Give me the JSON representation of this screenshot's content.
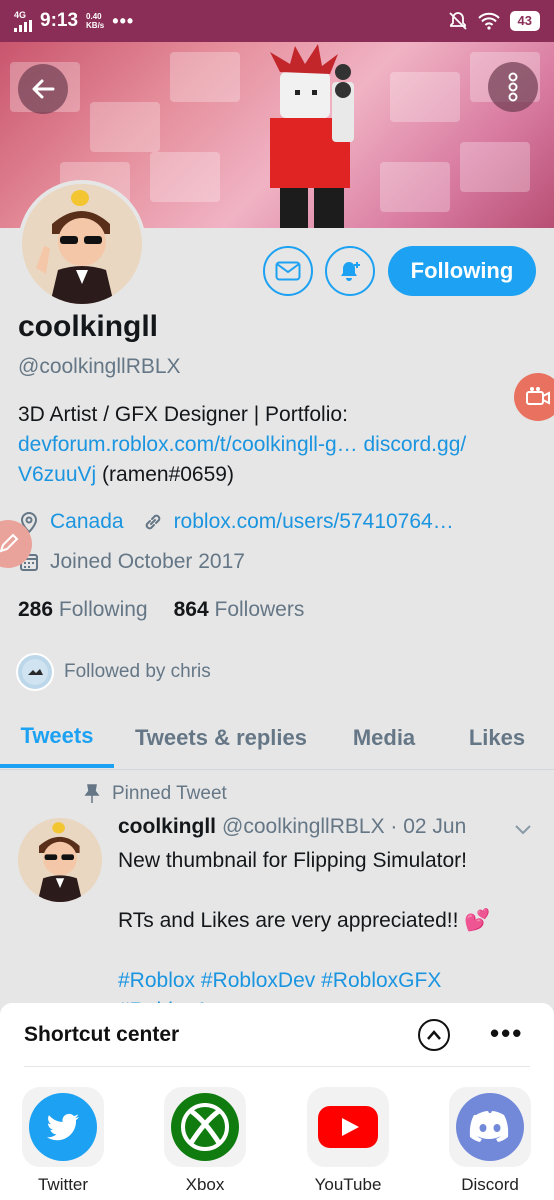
{
  "status_bar": {
    "network": "4G",
    "time": "9:13",
    "speed_value": "0.40",
    "speed_unit": "KB/s",
    "more": "•••",
    "battery": "43"
  },
  "profile": {
    "name": "coolkingll",
    "handle": "@coolkingllRBLX",
    "bio_text": "3D Artist / GFX Designer | Portfolio: ",
    "bio_link1": "devforum.roblox.com/t/coolkingll-g…",
    "bio_link2": "discord.gg/",
    "bio_link2b": "V6zuuVj",
    "bio_tail": " (ramen#0659)",
    "location": "Canada",
    "website": "roblox.com/users/57410764…",
    "joined": "Joined October 2017",
    "following_count": "286",
    "following_label": "Following",
    "followers_count": "864",
    "followers_label": "Followers",
    "followed_by": "Followed by chris",
    "follow_button": "Following"
  },
  "tabs": [
    {
      "label": "Tweets",
      "active": true
    },
    {
      "label": "Tweets & replies",
      "active": false
    },
    {
      "label": "Media",
      "active": false
    },
    {
      "label": "Likes",
      "active": false
    }
  ],
  "tweet": {
    "pinned_label": "Pinned Tweet",
    "author": "coolkingll",
    "handle_date": "@coolkingllRBLX · 02 Jun",
    "line1": "New thumbnail for Flipping Simulator!",
    "line2": "RTs and Likes are very appreciated!! 💕",
    "tags": "#Roblox #RobloxDev #RobloxGFX",
    "tags_cut": "#RobloxArt"
  },
  "shortcut_center": {
    "title": "Shortcut center",
    "more": "•••",
    "apps": [
      {
        "label": "Twitter",
        "color": "#1da1f2"
      },
      {
        "label": "Xbox",
        "color": "#107c10"
      },
      {
        "label": "YouTube",
        "color": "#ff0000"
      },
      {
        "label": "Discord",
        "color": "#7289da"
      }
    ]
  },
  "colors": {
    "accent": "#1da1f2",
    "status_bar": "#8a2e57",
    "muted_text": "#657786"
  }
}
